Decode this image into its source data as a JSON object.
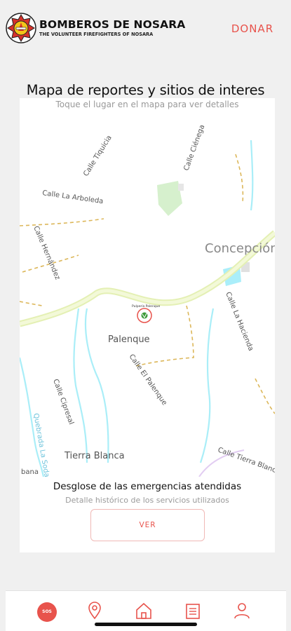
{
  "header": {
    "title": "BOMBEROS DE NOSARA",
    "subtitle": "THE VOLUNTEER FIREFIGHTERS OF NOSARA",
    "donate_label": "DONAR",
    "accent_color": "#e8534c"
  },
  "map_section": {
    "title": "Mapa de reportes y sitios de interes",
    "subtitle": "Toque el lugar en el mapa para ver detalles",
    "labels": {
      "calle_tiquicia": "Calle Tiquicia",
      "calle_cienega": "Calle Ciénega",
      "calle_arboleda": "Calle La Arboleda",
      "calle_hernandez": "Calle Hernández",
      "concepcion": "Concepción",
      "calle_la_hacienda": "Calle La Hacienda",
      "palenque": "Palenque",
      "calle_el_palenque": "Calle El Palenque",
      "calle_cipresal": "Calle Cipresal",
      "quebrada": "Quebrada La Soda",
      "tierra_blanca": "Tierra Blanca",
      "calle_tierra_blanca": "Calle Tierra Blanca",
      "bana": "bana",
      "pin_label": "Pulpería Palenque"
    }
  },
  "emergencies": {
    "title": "Desglose de las emergencias atendidas",
    "subtitle": "Detalle histórico de los servicios utilizados",
    "button_label": "VER"
  },
  "bottom_nav": {
    "items": [
      {
        "icon": "sos-icon",
        "label": "SOS"
      },
      {
        "icon": "location-pin-icon"
      },
      {
        "icon": "home-icon"
      },
      {
        "icon": "list-icon"
      },
      {
        "icon": "user-icon"
      }
    ]
  }
}
